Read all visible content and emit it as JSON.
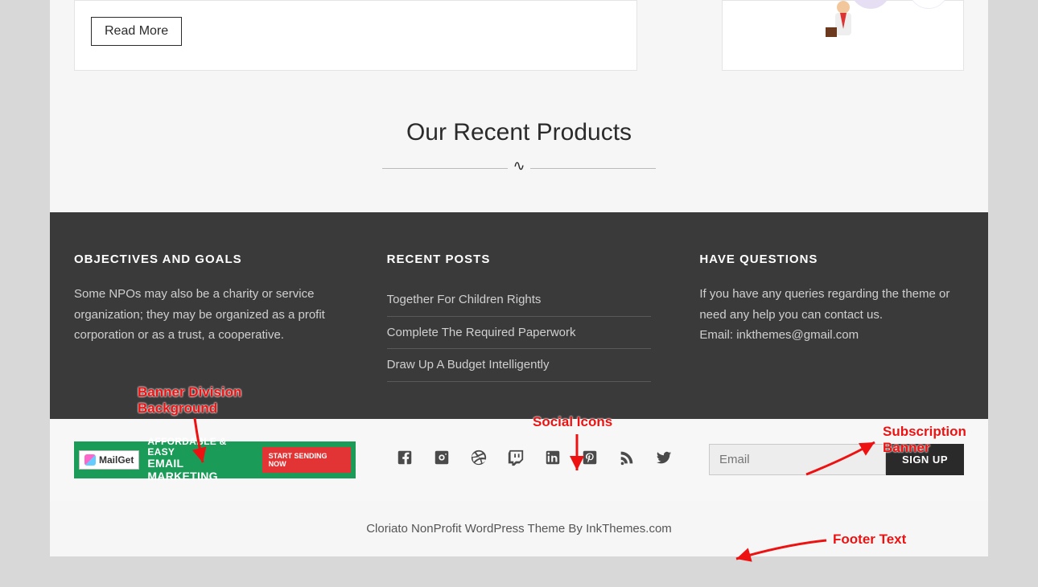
{
  "cards": {
    "read_more": "Read More"
  },
  "section": {
    "title": "Our Recent Products"
  },
  "footer": {
    "objectives": {
      "heading": "OBJECTIVES AND GOALS",
      "text": "Some NPOs may also be a charity or service organization; they may be organized as a profit corporation or as a trust, a cooperative."
    },
    "recent": {
      "heading": "RECENT POSTS",
      "items": [
        "Together For Children Rights",
        "Complete The Required Paperwork",
        "Draw Up A Budget Intelligently"
      ]
    },
    "questions": {
      "heading": "HAVE QUESTIONS",
      "text": "If you have any queries regarding the theme or need any help you can contact us.",
      "email_label": "Email: ",
      "email_value": "inkthemes@gmail.com"
    }
  },
  "mailget": {
    "logo": "MailGet",
    "line1": "AFFORDABLE & EASY",
    "line2": "EMAIL MARKETING",
    "cta": "START SENDING NOW"
  },
  "subscribe": {
    "placeholder": "Email",
    "button": "SIGN UP"
  },
  "copyright": "Cloriato NonProfit WordPress Theme By InkThemes.com",
  "annotations": {
    "banner_bg": "Banner Division\nBackground",
    "social": "Social Icons",
    "sub_banner": "Subscription Banner",
    "footer_text": "Footer Text"
  }
}
